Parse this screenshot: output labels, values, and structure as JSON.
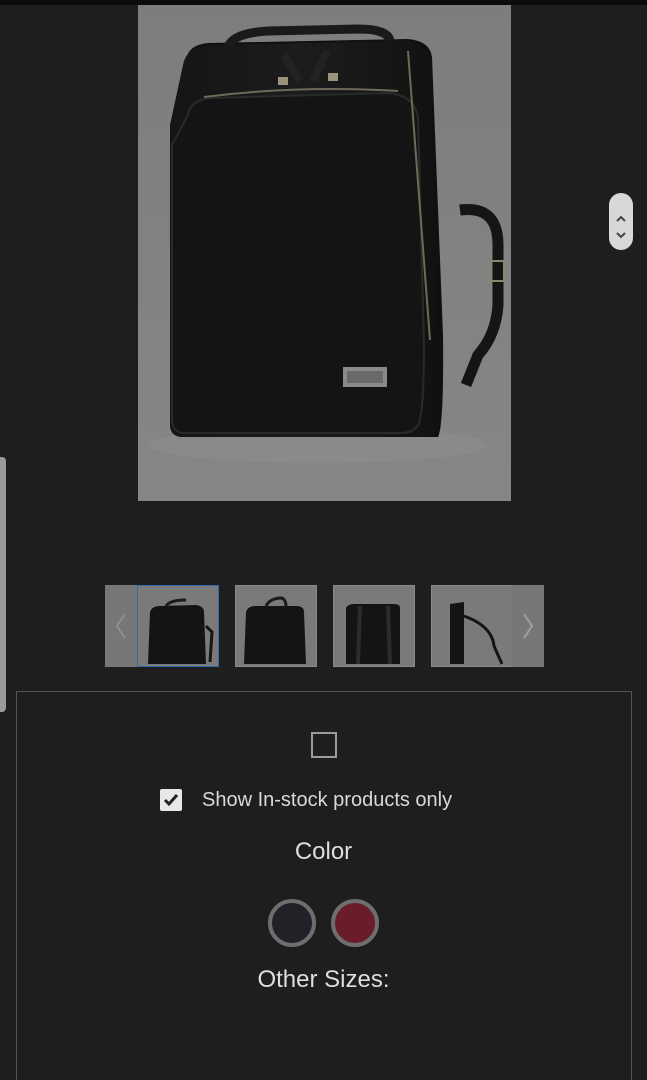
{
  "product": {
    "image_alt": "black leather backpack"
  },
  "thumbnails": [
    {
      "name": "front-view"
    },
    {
      "name": "front-flat-view"
    },
    {
      "name": "back-view"
    },
    {
      "name": "side-view"
    }
  ],
  "filters": {
    "instock_label": "Show In-stock products only",
    "instock_checked": true,
    "color_title": "Color",
    "colors": [
      {
        "name": "black",
        "hex": "#232028"
      },
      {
        "name": "burgundy",
        "hex": "#6a1c2a"
      }
    ],
    "other_sizes_title": "Other Sizes:"
  },
  "icons": {
    "scroll_up": "chevron-up-icon",
    "scroll_down": "chevron-down-icon",
    "thumb_prev": "chevron-left-icon",
    "thumb_next": "chevron-right-icon",
    "check": "checkmark-icon"
  },
  "colors": {
    "background": "#1e1e1e",
    "panel_border": "#555555",
    "active_thumb_border": "#2f6db0",
    "text": "#dedede"
  }
}
